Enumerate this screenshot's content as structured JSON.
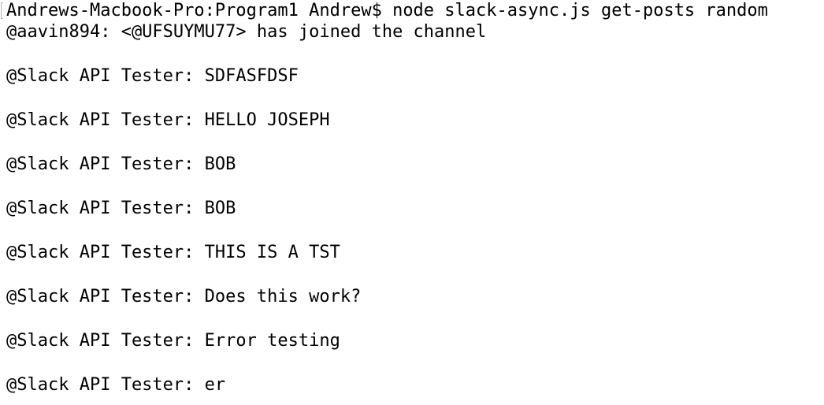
{
  "terminal": {
    "command_line": "Andrews-Macbook-Pro:Program1 Andrew$ node slack-async.js get-posts random",
    "join_line": "@aavin894: <@UFSUYMU77> has joined the channel",
    "messages": [
      "@Slack API Tester: SDFASFDSF",
      "@Slack API Tester: HELLO JOSEPH",
      "@Slack API Tester: BOB",
      "@Slack API Tester: BOB",
      "@Slack API Tester: THIS IS A TST",
      "@Slack API Tester: Does this work?",
      "@Slack API Tester: Error testing",
      "@Slack API Tester: er"
    ]
  },
  "colors": {
    "background": "#ffffff",
    "text": "#000000",
    "mark": "#b8b8b8"
  }
}
